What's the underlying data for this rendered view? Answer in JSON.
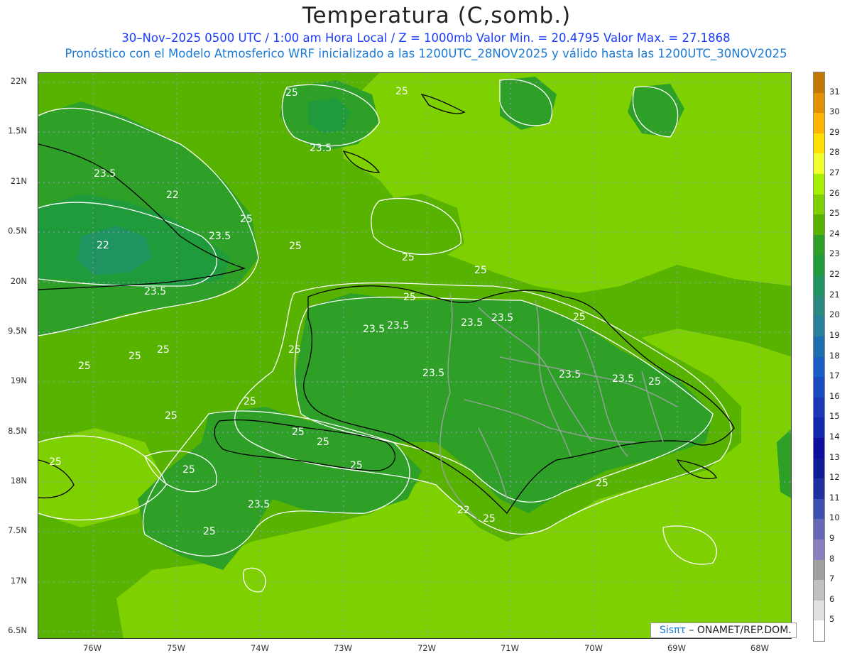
{
  "title": "Temperatura (C,somb.)",
  "subtitle1": "30–Nov–2025  0500 UTC / 1:00 am Hora Local / Z = 1000mb    Valor Min. = 20.4795   Valor Max. = 27.1868",
  "subtitle2": "Pronóstico con el Modelo Atmosferico WRF inicializado a las 1200UTC_28NOV2025 y válido hasta las  1200UTC_30NOV2025",
  "credit": {
    "brand": "Sisπτ",
    "text": "– ONAMET/REP.DOM."
  },
  "lat_labels": [
    "22N",
    "1.5N",
    "21N",
    "0.5N",
    "20N",
    "9.5N",
    "19N",
    "8.5N",
    "18N",
    "7.5N",
    "17N",
    "6.5N"
  ],
  "lon_labels": [
    "76W",
    "75W",
    "74W",
    "73W",
    "72W",
    "71W",
    "70W",
    "69W",
    "68W"
  ],
  "colorbar": {
    "labels": [
      "31",
      "30",
      "29",
      "28",
      "27",
      "26",
      "25",
      "24",
      "23",
      "22",
      "21",
      "20",
      "19",
      "18",
      "17",
      "16",
      "15",
      "14",
      "13",
      "12",
      "11",
      "10",
      "9",
      "8",
      "7",
      "6",
      "5"
    ],
    "colors": [
      "#c07800",
      "#e09000",
      "#ffb400",
      "#ffe000",
      "#f0ff30",
      "#a8ee00",
      "#7ed000",
      "#57b300",
      "#2ea028",
      "#1f9b3c",
      "#1f9460",
      "#2a8a80",
      "#2a7f9a",
      "#1c70b0",
      "#1a5fc8",
      "#1a4ac0",
      "#1a38b8",
      "#1428b0",
      "#1010a0",
      "#101c98",
      "#2030a0",
      "#4050b0",
      "#6668b8",
      "#8a80c0",
      "#a0a0a0",
      "#c0c0c0",
      "#e0e0e0",
      "#ffffff"
    ]
  },
  "contour_labels": [
    "25",
    "25",
    "25",
    "25",
    "25",
    "25",
    "25",
    "25",
    "25",
    "25",
    "25",
    "25",
    "25",
    "25",
    "25",
    "25",
    "25",
    "25",
    "25",
    "25",
    "25",
    "25",
    "25",
    "23.5",
    "23.5",
    "23.5",
    "23.5",
    "23.5",
    "23.5",
    "23.5",
    "23.5",
    "23.5",
    "23.5",
    "23.5",
    "23.5",
    "22",
    "22",
    "22"
  ],
  "colors": {
    "background_field": "#57b300",
    "light_field": "#7ed000",
    "dark_field": "#2ea028",
    "cool_pocket": "#1f9460",
    "contour": "#ffffff",
    "coastline": "#000000",
    "province_border": "#9aa0a0"
  }
}
